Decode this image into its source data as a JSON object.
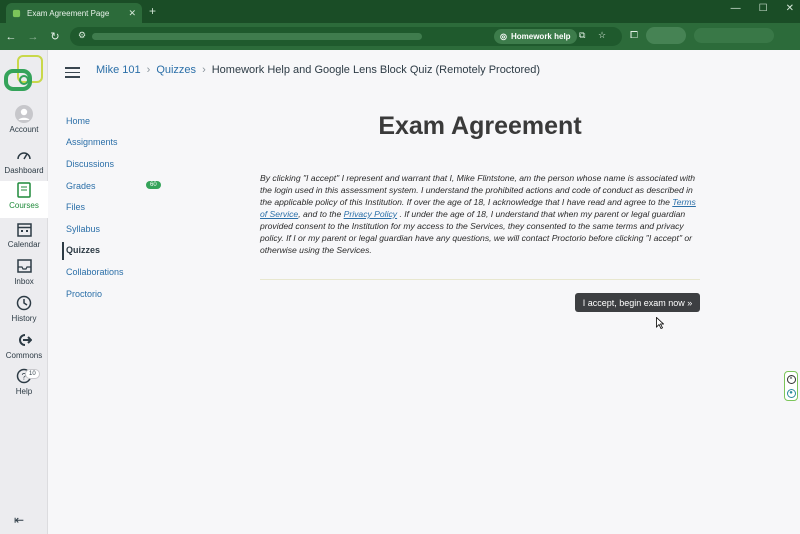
{
  "browser": {
    "tab_title": "Exam Agreement Page",
    "tab_close": "✕",
    "new_tab": "+",
    "chip_label": "Homework help",
    "win_min": "—",
    "win_max": "☐",
    "win_close": "✕"
  },
  "global_nav": {
    "items": [
      {
        "label": "Account",
        "icon": "avatar-icon"
      },
      {
        "label": "Dashboard",
        "icon": "dashboard-icon"
      },
      {
        "label": "Courses",
        "icon": "courses-icon"
      },
      {
        "label": "Calendar",
        "icon": "calendar-icon"
      },
      {
        "label": "Inbox",
        "icon": "inbox-icon"
      },
      {
        "label": "History",
        "icon": "history-icon"
      },
      {
        "label": "Commons",
        "icon": "commons-icon"
      },
      {
        "label": "Help",
        "icon": "help-icon"
      }
    ],
    "help_badge": "10"
  },
  "breadcrumb": {
    "course": "Mike 101",
    "section": "Quizzes",
    "page": "Homework Help and Google Lens Block Quiz (Remotely Proctored)"
  },
  "course_nav": {
    "items": [
      "Home",
      "Assignments",
      "Discussions",
      "Grades",
      "Files",
      "Syllabus",
      "Quizzes",
      "Collaborations",
      "Proctorio"
    ],
    "grades_badge": "60",
    "active": "Quizzes"
  },
  "main": {
    "title": "Exam Agreement",
    "agreement_p1": "By clicking \"I accept\" I represent and warrant that I, Mike Flintstone, am the person whose name is associated with the login used in this assessment system. I understand the prohibited actions and code of conduct as described in the applicable policy of this Institution. If over the age of 18, I acknowledge that I have read and agree to the ",
    "terms_link": "Terms of Service",
    "agreement_p2": ", and to the ",
    "privacy_link": "Privacy Policy",
    "agreement_p3": " . If under the age of 18, I understand that when my parent or legal guardian provided consent to the Institution for my access to the Services, they consented to the same terms and privacy policy. If I or my parent or legal guardian have any questions, we will contact Proctorio before clicking \"I accept\" or otherwise using the Services.",
    "accept_button": "I accept, begin exam now »"
  },
  "colors": {
    "chrome": "#2c6b3a",
    "active_nav": "#1f8a3a",
    "link": "#2b6fa8",
    "accept_button": "#3d3f42"
  }
}
